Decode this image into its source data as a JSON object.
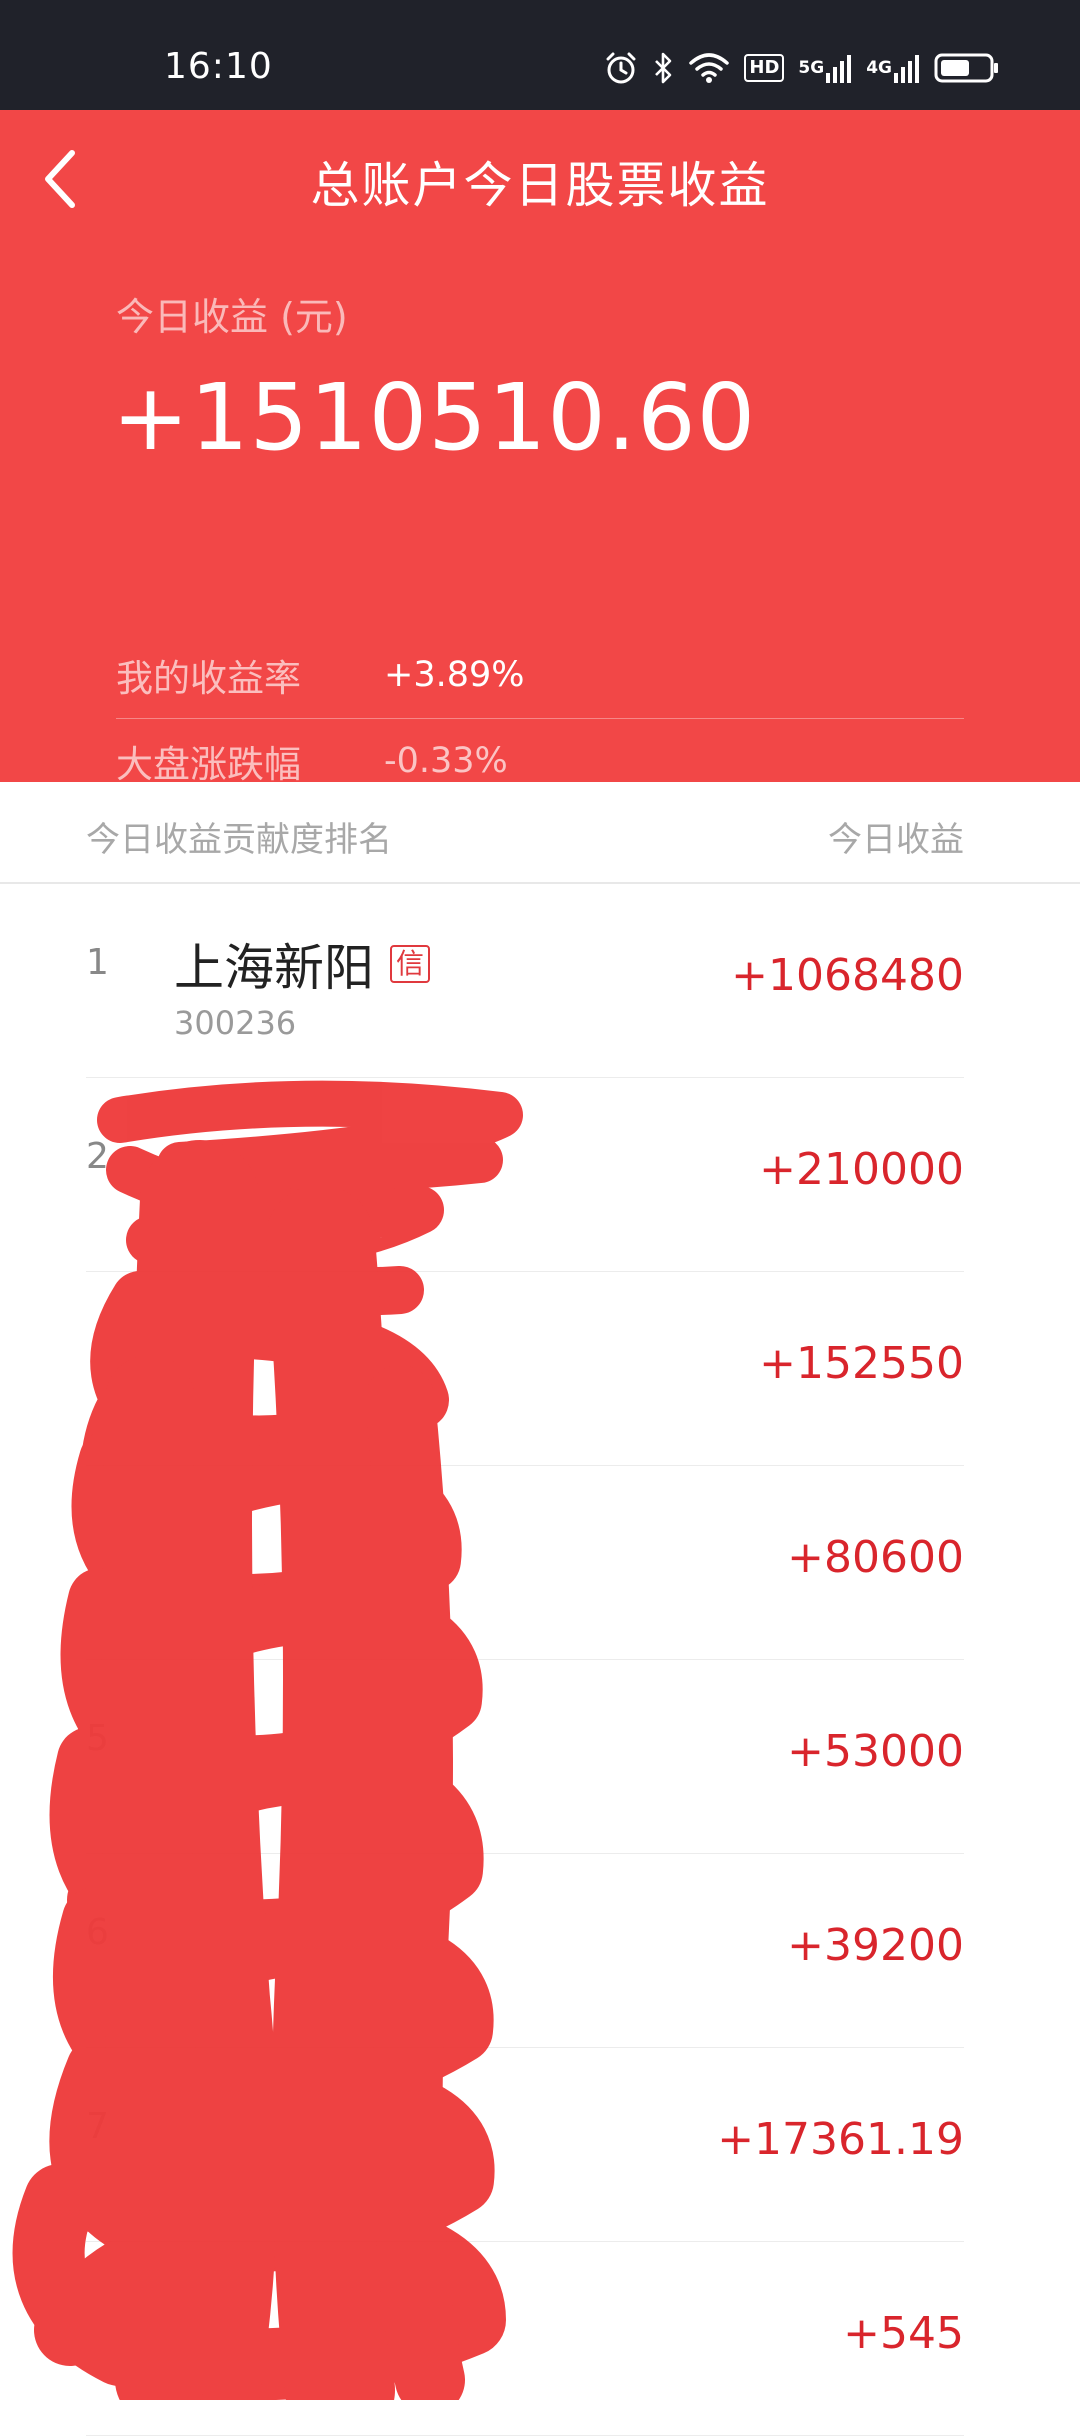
{
  "status_bar": {
    "time": "16:10",
    "icons": [
      "alarm-icon",
      "bluetooth-icon",
      "wifi-icon",
      "hd-icon",
      "signal-5g-icon",
      "signal-4g-icon",
      "battery-icon"
    ],
    "hd_label": "HD",
    "net1_label": "5G",
    "net2_label": "4G"
  },
  "header": {
    "title": "总账户今日股票收益",
    "profit_label": "今日收益 (元)",
    "profit_value": "+1510510.60",
    "yield_label": "我的收益率",
    "yield_value": "+3.89%",
    "market_label": "大盘涨跌幅",
    "market_value": "-0.33%"
  },
  "list_header": {
    "left": "今日收益贡献度排名",
    "right": "今日收益"
  },
  "items": [
    {
      "rank": "1",
      "name": "上海新阳",
      "tag": "信",
      "code": "300236",
      "profit": "+1068480"
    },
    {
      "rank": "2",
      "name": "",
      "tag": "",
      "code": "",
      "profit": "+210000"
    },
    {
      "rank": "",
      "name": "",
      "tag": "",
      "code": "",
      "profit": "+152550"
    },
    {
      "rank": "",
      "name": "",
      "tag": "",
      "code": "",
      "profit": "+80600"
    },
    {
      "rank": "5",
      "name": "",
      "tag": "",
      "code": "",
      "profit": "+53000"
    },
    {
      "rank": "6",
      "name": "",
      "tag": "",
      "code": "",
      "profit": "+39200"
    },
    {
      "rank": "7",
      "name": "",
      "tag": "",
      "code": "",
      "profit": "+17361.19"
    },
    {
      "rank": "",
      "name": "",
      "tag": "",
      "code": "",
      "profit": "+545"
    }
  ],
  "colors": {
    "header_bg": "#f24747",
    "status_bg": "#20222a",
    "profit_text": "#d9252c",
    "scribble": "#ee3b3b"
  }
}
